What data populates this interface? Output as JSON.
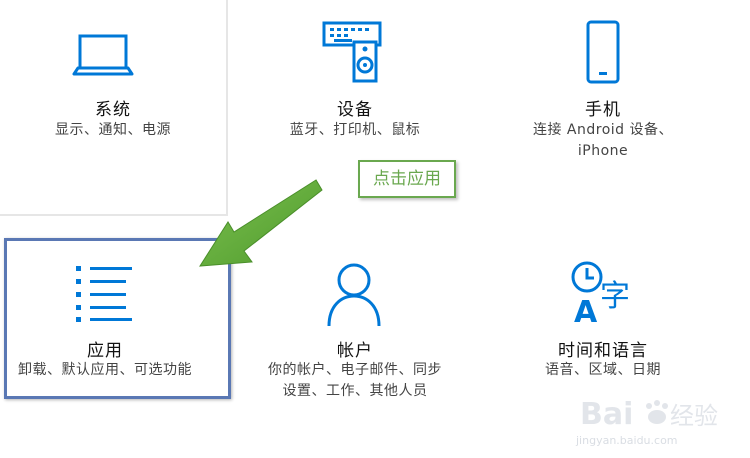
{
  "tiles": {
    "system": {
      "title": "系统",
      "desc": "显示、通知、电源"
    },
    "devices": {
      "title": "设备",
      "desc": "蓝牙、打印机、鼠标"
    },
    "phone": {
      "title": "手机",
      "desc_line1": "连接 Android 设备、",
      "desc_line2": "iPhone"
    },
    "apps": {
      "title": "应用",
      "desc": "卸载、默认应用、可选功能"
    },
    "accounts": {
      "title": "帐户",
      "desc_line1": "你的帐户、电子邮件、同步",
      "desc_line2": "设置、工作、其他人员"
    },
    "time_language": {
      "title": "时间和语言",
      "desc": "语音、区域、日期"
    }
  },
  "annotation": {
    "label": "点击应用"
  },
  "icons": {
    "system": "laptop-icon",
    "devices": "keyboard-speaker-icon",
    "phone": "phone-icon",
    "apps": "list-icon",
    "accounts": "person-icon",
    "time_language": "clock-language-icon"
  },
  "colors": {
    "accent": "#0078d7",
    "annotation_green": "#6aa84f",
    "highlight_blue": "#5a78b4"
  },
  "watermark": {
    "logo_text": "Bai 经验",
    "url": "jingyan.baidu.com"
  }
}
